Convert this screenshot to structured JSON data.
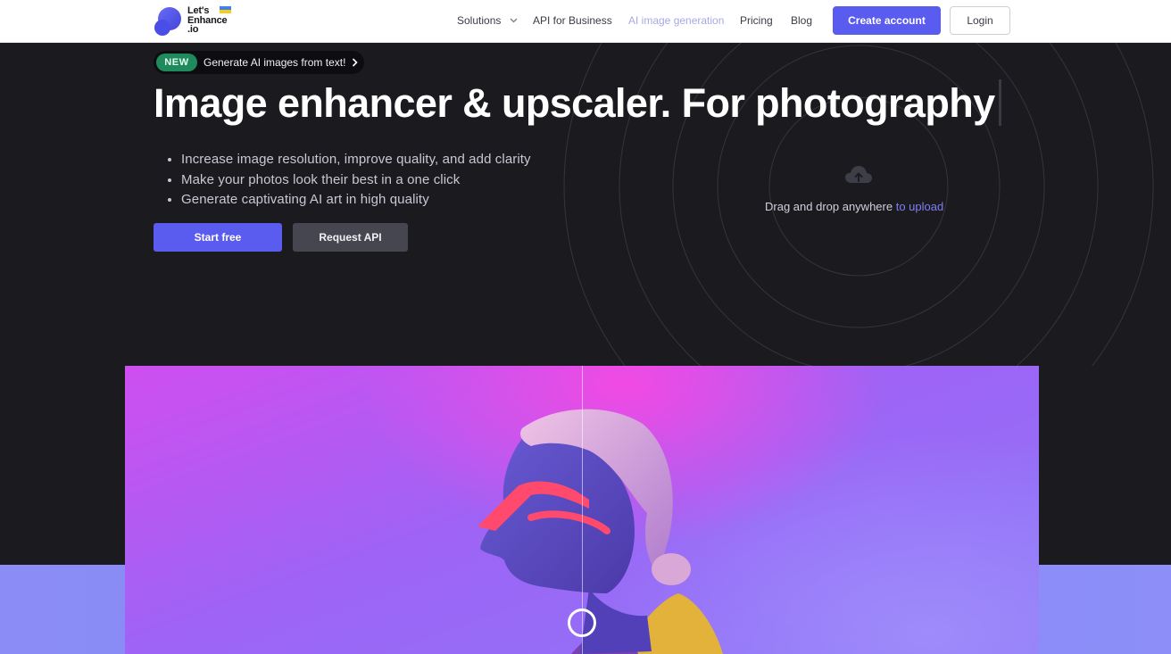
{
  "brand": {
    "line1": "Let's",
    "line2": "Enhance",
    "line3": ".io",
    "primary_color": "#5a5cf0",
    "flag_colors": [
      "#3b82f6",
      "#facc15"
    ]
  },
  "nav": {
    "solutions": "Solutions",
    "api_business": "API for Business",
    "ai_generation": "AI image generation",
    "pricing": "Pricing",
    "blog": "Blog",
    "create_account": "Create account",
    "login": "Login"
  },
  "hero": {
    "badge": "NEW",
    "announcement": "Generate AI images from text!",
    "title": "Image enhancer & upscaler. For photography",
    "bullets": [
      "Increase image resolution, improve quality, and add clarity",
      "Make your photos look their best in a one click",
      "Generate captivating AI art in high quality"
    ],
    "start_free": "Start free",
    "request_api": "Request API"
  },
  "upload": {
    "icon": "cloud-upload-icon",
    "text": "Drag and drop anywhere",
    "link": "to upload"
  },
  "comparison": {
    "handle_icon": "circle-handle-icon"
  }
}
